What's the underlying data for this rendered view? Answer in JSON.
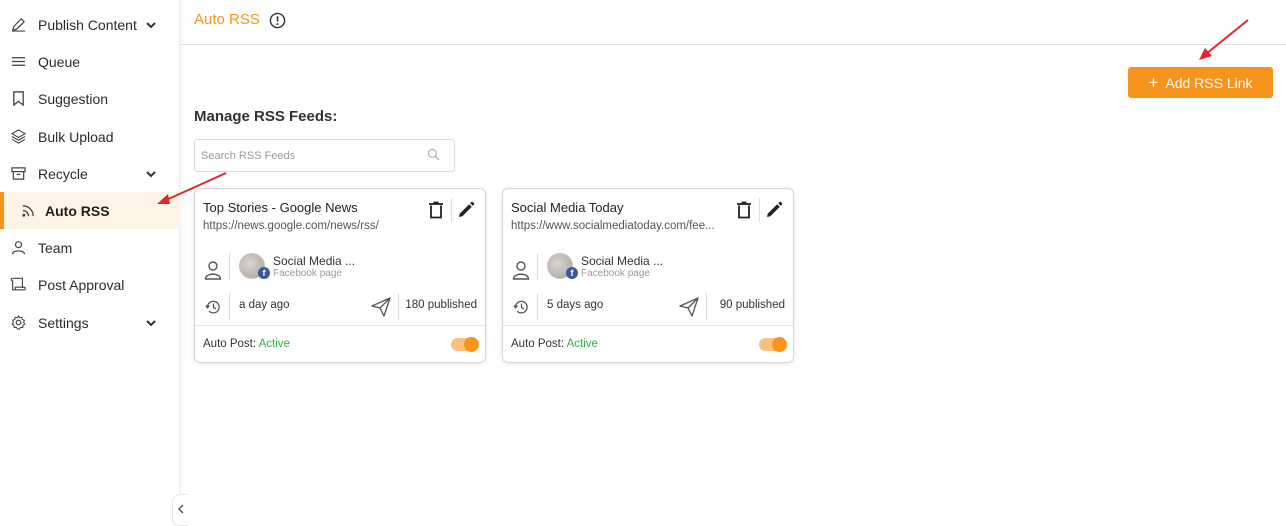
{
  "sidebar": {
    "items": [
      {
        "label": "Publish Content",
        "icon": "pencil-icon",
        "chevron": true
      },
      {
        "label": "Queue",
        "icon": "list-icon",
        "chevron": false
      },
      {
        "label": "Suggestion",
        "icon": "bookmark-icon",
        "chevron": false
      },
      {
        "label": "Bulk Upload",
        "icon": "layers-icon",
        "chevron": false
      },
      {
        "label": "Recycle",
        "icon": "archive-icon",
        "chevron": true
      },
      {
        "label": "Auto RSS",
        "icon": "rss-icon",
        "chevron": false,
        "active": true
      },
      {
        "label": "Team",
        "icon": "user-icon",
        "chevron": false
      },
      {
        "label": "Post Approval",
        "icon": "scroll-icon",
        "chevron": false
      },
      {
        "label": "Settings",
        "icon": "gear-icon",
        "chevron": true
      }
    ]
  },
  "header": {
    "title": "Auto RSS"
  },
  "toolbar": {
    "add_label": "Add RSS Link"
  },
  "main": {
    "section_title": "Manage RSS Feeds:",
    "search_placeholder": "Search RSS Feeds"
  },
  "feeds": [
    {
      "title": "Top Stories - Google News",
      "url": "https://news.google.com/news/rss/",
      "account_name": "Social Media ...",
      "account_type": "Facebook page",
      "last_run": "a day ago",
      "published": "180 published",
      "auto_post_label": "Auto Post:",
      "auto_post_status": "Active"
    },
    {
      "title": "Social Media Today",
      "url": "https://www.socialmediatoday.com/fee...",
      "account_name": "Social Media ...",
      "account_type": "Facebook page",
      "last_run": "5 days ago",
      "published": "90 published",
      "auto_post_label": "Auto Post:",
      "auto_post_status": "Active"
    }
  ],
  "colors": {
    "accent": "#f7941d",
    "active_status": "#2fb344",
    "annotation_arrow": "#e3262b"
  }
}
